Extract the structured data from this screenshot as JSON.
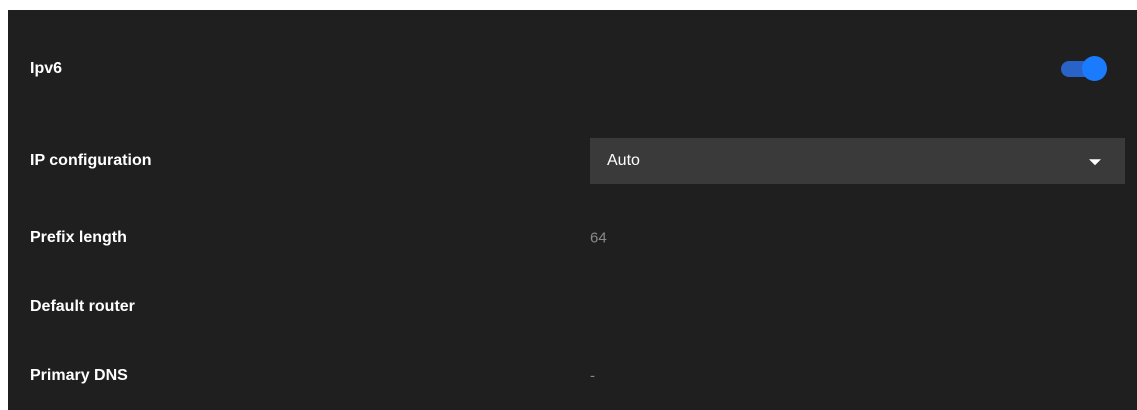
{
  "settings": {
    "ipv6": {
      "label": "Ipv6",
      "enabled": true,
      "accent_color": "#1a7bff"
    },
    "ip_configuration": {
      "label": "IP configuration",
      "selected": "Auto"
    },
    "prefix_length": {
      "label": "Prefix length",
      "value": "64"
    },
    "default_router": {
      "label": "Default router",
      "value": ""
    },
    "primary_dns": {
      "label": "Primary DNS",
      "value": "-"
    }
  }
}
